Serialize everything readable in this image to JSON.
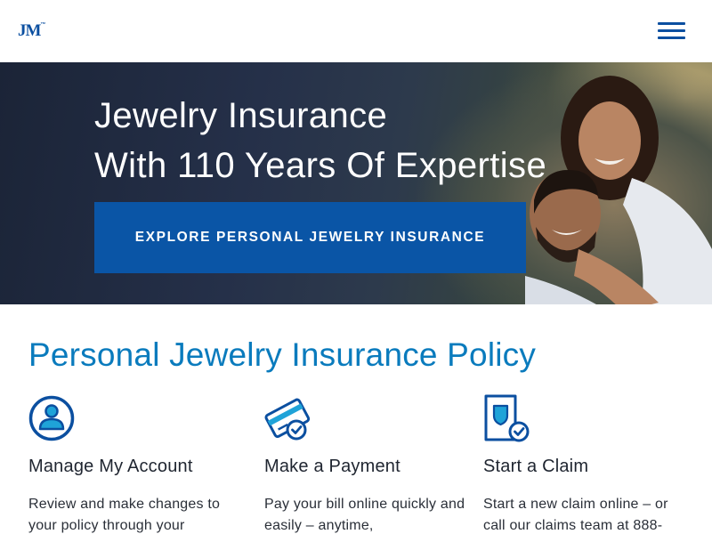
{
  "header": {
    "logo_text": "JM",
    "logo_mark": "™",
    "menu_icon": "hamburger-menu-icon"
  },
  "hero": {
    "title_line1": "Jewelry Insurance",
    "title_line2": "With 110 Years Of Expertise",
    "cta_label": "EXPLORE PERSONAL JEWELRY INSURANCE"
  },
  "section": {
    "title": "Personal Jewelry Insurance Policy",
    "cards": [
      {
        "icon": "account-user-icon",
        "title": "Manage My Account",
        "body": "Review and make changes to your policy through your"
      },
      {
        "icon": "credit-card-check-icon",
        "title": "Make a Payment",
        "body": "Pay your bill online quickly and easily – anytime,"
      },
      {
        "icon": "claim-document-check-icon",
        "title": "Start a Claim",
        "body": "Start a new claim online – or call our claims team at 888-"
      }
    ]
  },
  "colors": {
    "brand_blue": "#0a55a6",
    "title_blue": "#0a7bbd",
    "icon_blue": "#0b4fa0",
    "icon_teal": "#1fa3d8"
  }
}
